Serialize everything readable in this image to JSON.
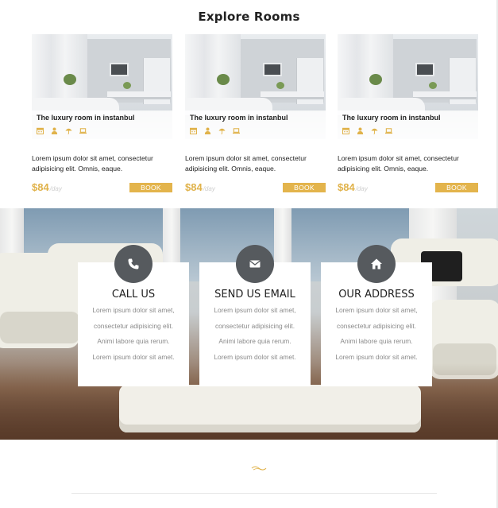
{
  "section": {
    "title": "Explore Rooms"
  },
  "rooms": [
    {
      "name": "The luxury room in instanbul",
      "description": "Lorem ipsum dolor sit amet, consectetur adipisicing elit. Omnis, eaque.",
      "price": "$84",
      "per": "/day",
      "book_label": "BOOK"
    },
    {
      "name": "The luxury room in instanbul",
      "description": "Lorem ipsum dolor sit amet, consectetur adipisicing elit. Omnis, eaque.",
      "price": "$84",
      "per": "/day",
      "book_label": "BOOK"
    },
    {
      "name": "The luxury room in instanbul",
      "description": "Lorem ipsum dolor sit amet, consectetur adipisicing elit. Omnis, eaque.",
      "price": "$84",
      "per": "/day",
      "book_label": "BOOK"
    }
  ],
  "amenity_icons": [
    "calendar-icon",
    "person-icon",
    "umbrella-icon",
    "laptop-icon"
  ],
  "contacts": [
    {
      "icon": "phone-icon",
      "title": "CALL US",
      "lines": [
        "Lorem ipsum dolor sit amet,",
        "consectetur adipisicing elit.",
        "Animi labore quia rerum.",
        "Lorem ipsum dolor sit amet."
      ]
    },
    {
      "icon": "envelope-icon",
      "title": "SEND US EMAIL",
      "lines": [
        "Lorem ipsum dolor sit amet,",
        "consectetur adipisicing elit.",
        "Animi labore quia rerum.",
        "Lorem ipsum dolor sit amet."
      ]
    },
    {
      "icon": "home-icon",
      "title": "OUR ADDRESS",
      "lines": [
        "Lorem ipsum dolor sit amet,",
        "consectetur adipisicing elit.",
        "Animi labore quia rerum.",
        "Lorem ipsum dolor sit amet."
      ]
    }
  ],
  "colors": {
    "accent": "#e3b44c",
    "price": "#e0b24a",
    "icon_circle": "#565a5e",
    "body_text": "#222222",
    "muted_text": "#8a8a8a"
  }
}
